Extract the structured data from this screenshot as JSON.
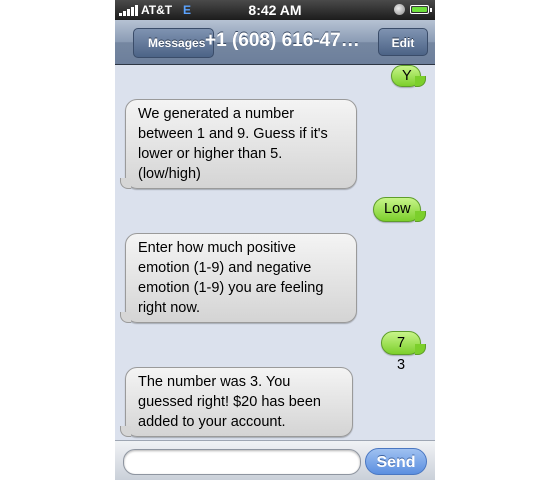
{
  "status_bar": {
    "carrier": "AT&T",
    "network": "E",
    "time": "8:42 AM",
    "signal_bars": 5,
    "battery_level": 1.0
  },
  "nav": {
    "back_label": "Messages",
    "title": "+1 (608) 616-47…",
    "edit_label": "Edit"
  },
  "messages": [
    {
      "from": "me",
      "text": "Y"
    },
    {
      "from": "them",
      "lines": [
        "We generated a number",
        "between 1 and 9. Guess if it's",
        "lower or higher than 5.",
        "(low/high)"
      ]
    },
    {
      "from": "me",
      "text": "Low"
    },
    {
      "from": "them",
      "lines": [
        "Enter how much positive",
        "emotion (1-9) and negative",
        "emotion (1-9) you are feeling",
        "right now."
      ]
    },
    {
      "from": "me",
      "text": "7 3"
    },
    {
      "from": "them",
      "lines": [
        "The number was 3. You",
        "guessed right! $20 has been",
        "added to your account."
      ]
    }
  ],
  "compose": {
    "input_value": "",
    "send_label": "Send"
  },
  "colors": {
    "outgoing_bubble": "#8fd93f",
    "incoming_bubble": "#e4e4e4",
    "thread_background": "#dbe1ed",
    "send_button": "#6b9de6"
  },
  "icons": [
    "signal-bars-icon",
    "screen-lock-icon",
    "battery-icon",
    "back-arrow-icon"
  ]
}
